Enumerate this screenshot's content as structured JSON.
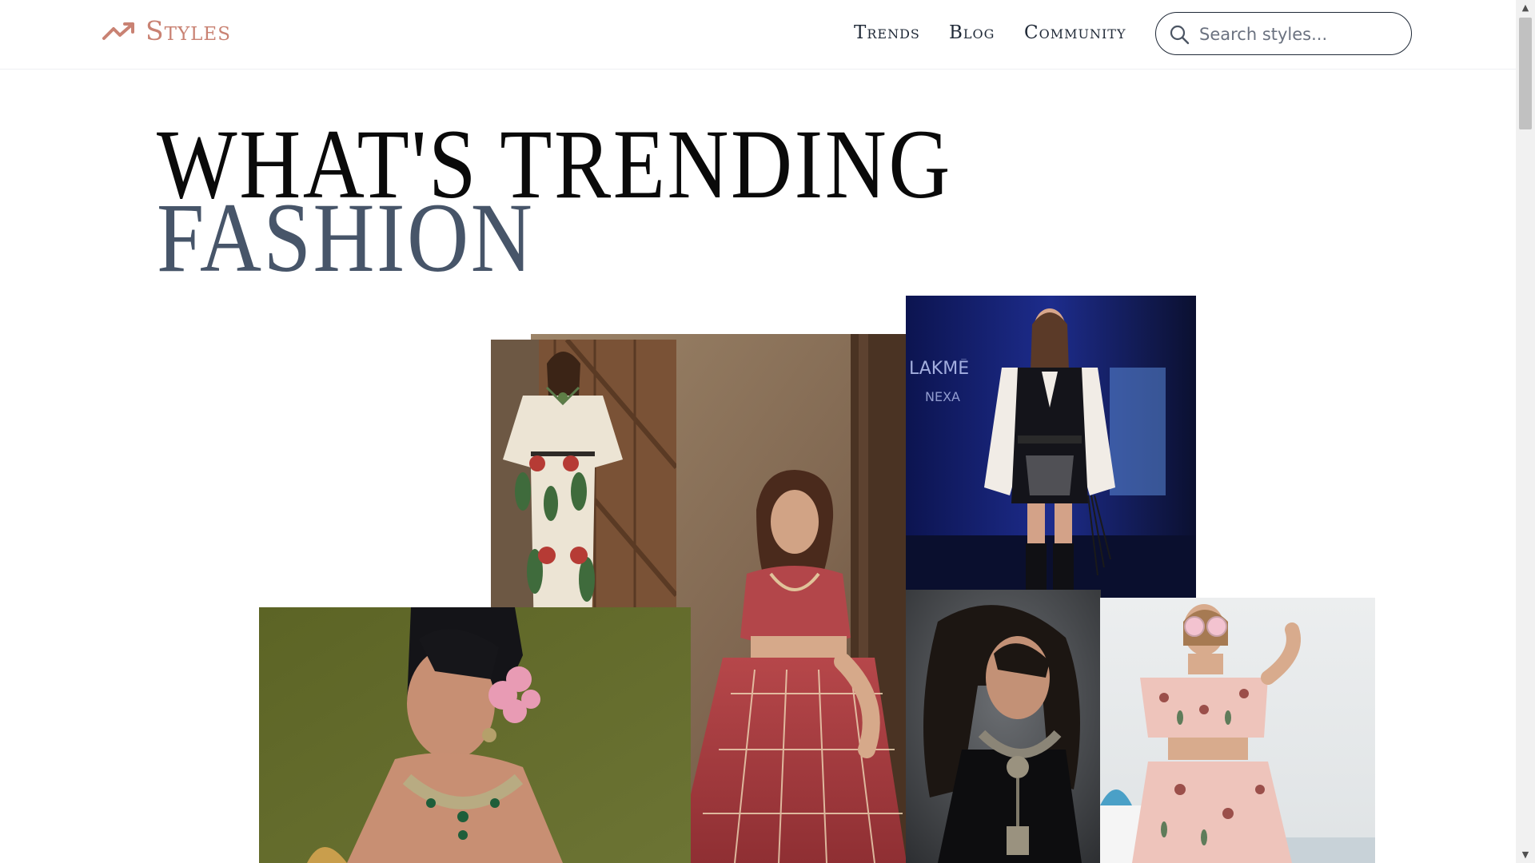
{
  "brand": {
    "name": "Styles",
    "icon": "trending-up-icon",
    "color": "#c98273"
  },
  "nav": {
    "items": [
      "Trends",
      "Blog",
      "Community"
    ]
  },
  "search": {
    "placeholder": "Search styles...",
    "value": "",
    "icon": "search-icon"
  },
  "hero": {
    "line1": "WHAT'S TRENDING",
    "line2": "FASHION"
  },
  "gallery": {
    "tiles": [
      {
        "name": "photo-floral-kaftan-set",
        "alt": "Model in white floral kaftan set by a wooden door"
      },
      {
        "name": "photo-red-lehenga",
        "alt": "Model in embroidered red lehenga"
      },
      {
        "name": "photo-runway-black-vest",
        "alt": "Model on runway in black embroidered vest"
      },
      {
        "name": "photo-statement-choker",
        "alt": "Model wearing emerald statement choker and pink flowers"
      },
      {
        "name": "photo-oxidised-necklace",
        "alt": "Model with oxidised silver necklace and wavy hair"
      },
      {
        "name": "photo-floral-co-ord",
        "alt": "Model in floral off-shoulder co-ord with pink sunglasses"
      }
    ]
  },
  "colors": {
    "accent": "#c98273",
    "text": "#1f2937",
    "hero_secondary": "#475569"
  }
}
